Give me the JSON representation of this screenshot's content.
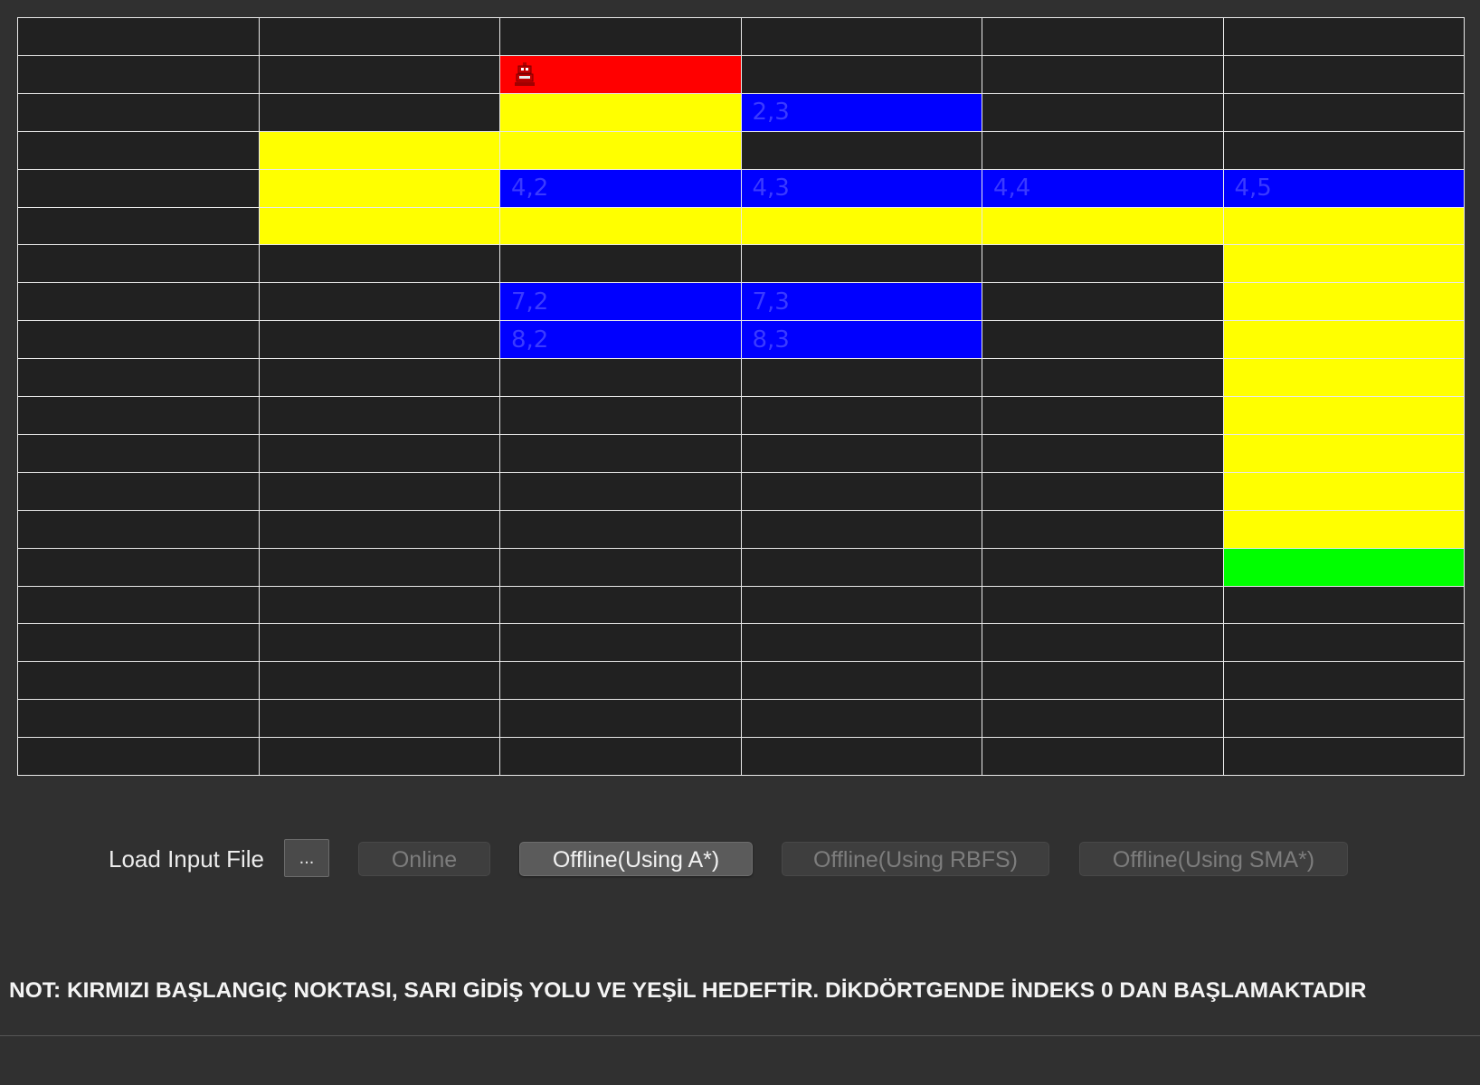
{
  "grid": {
    "rows": 20,
    "cols": 6,
    "colors": {
      "empty": "#212121",
      "start": "#ff0000",
      "path": "#ffff00",
      "obstacle": "#0000ff",
      "goal": "#00ff00",
      "label": "#3a3aff"
    },
    "cells": [
      {
        "r": 1,
        "c": 2,
        "type": "start",
        "icon": "robot-icon"
      },
      {
        "r": 2,
        "c": 2,
        "type": "path"
      },
      {
        "r": 2,
        "c": 3,
        "type": "obstacle",
        "label": "2,3"
      },
      {
        "r": 3,
        "c": 1,
        "type": "path"
      },
      {
        "r": 3,
        "c": 2,
        "type": "path"
      },
      {
        "r": 4,
        "c": 1,
        "type": "path"
      },
      {
        "r": 4,
        "c": 2,
        "type": "obstacle",
        "label": "4,2"
      },
      {
        "r": 4,
        "c": 3,
        "type": "obstacle",
        "label": "4,3"
      },
      {
        "r": 4,
        "c": 4,
        "type": "obstacle",
        "label": "4,4"
      },
      {
        "r": 4,
        "c": 5,
        "type": "obstacle",
        "label": "4,5"
      },
      {
        "r": 5,
        "c": 1,
        "type": "path"
      },
      {
        "r": 5,
        "c": 2,
        "type": "path"
      },
      {
        "r": 5,
        "c": 3,
        "type": "path"
      },
      {
        "r": 5,
        "c": 4,
        "type": "path"
      },
      {
        "r": 5,
        "c": 5,
        "type": "path"
      },
      {
        "r": 6,
        "c": 5,
        "type": "path"
      },
      {
        "r": 7,
        "c": 2,
        "type": "obstacle",
        "label": "7,2"
      },
      {
        "r": 7,
        "c": 3,
        "type": "obstacle",
        "label": "7,3"
      },
      {
        "r": 7,
        "c": 5,
        "type": "path"
      },
      {
        "r": 8,
        "c": 2,
        "type": "obstacle",
        "label": "8,2"
      },
      {
        "r": 8,
        "c": 3,
        "type": "obstacle",
        "label": "8,3"
      },
      {
        "r": 8,
        "c": 5,
        "type": "path"
      },
      {
        "r": 9,
        "c": 5,
        "type": "path"
      },
      {
        "r": 10,
        "c": 5,
        "type": "path"
      },
      {
        "r": 11,
        "c": 5,
        "type": "path"
      },
      {
        "r": 12,
        "c": 5,
        "type": "path"
      },
      {
        "r": 13,
        "c": 5,
        "type": "path"
      },
      {
        "r": 14,
        "c": 5,
        "type": "goal"
      }
    ]
  },
  "controls": {
    "load_label": "Load Input File",
    "browse_label": "...",
    "online_label": "Online",
    "astar_label": "Offline(Using A*)",
    "rbfs_label": "Offline(Using RBFS)",
    "sma_label": "Offline(Using SMA*)"
  },
  "note": "NOT: KIRMIZI BAŞLANGIÇ NOKTASI, SARI GİDİŞ YOLU VE YEŞİL HEDEFTİR. DİKDÖRTGENDE İNDEKS 0 DAN BAŞLAMAKTADIR"
}
